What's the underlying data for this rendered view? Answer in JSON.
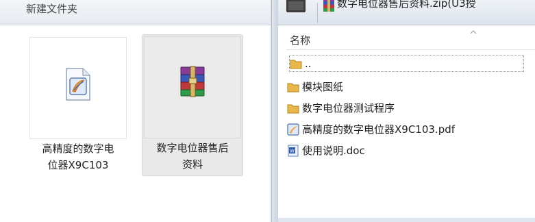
{
  "left_pane": {
    "title": "新建文件夹",
    "items": [
      {
        "label_line1": "高精度的数字电",
        "label_line2": "位器X9C103",
        "icon": "pdf-file-icon"
      },
      {
        "label_line1": "数字电位器售后",
        "label_line2": "资料",
        "icon": "winrar-archive-icon"
      }
    ]
  },
  "archive_window": {
    "path_title": "数字电位器售后资料.zip(U3授",
    "column_name_header": "名称",
    "rows": [
      {
        "label": "..",
        "icon": "folder-up-icon"
      },
      {
        "label": "模块图纸",
        "icon": "folder-icon"
      },
      {
        "label": "数字电位器测试程序",
        "icon": "folder-icon"
      },
      {
        "label": "高精度的数字电位器X9C103.pdf",
        "icon": "pdf-file-icon"
      },
      {
        "label": "使用说明.doc",
        "icon": "word-doc-icon"
      }
    ]
  },
  "colors": {
    "folder": "#e8b84a",
    "selected_tile": "#e9e9e9",
    "frame": "#c9d4df"
  }
}
